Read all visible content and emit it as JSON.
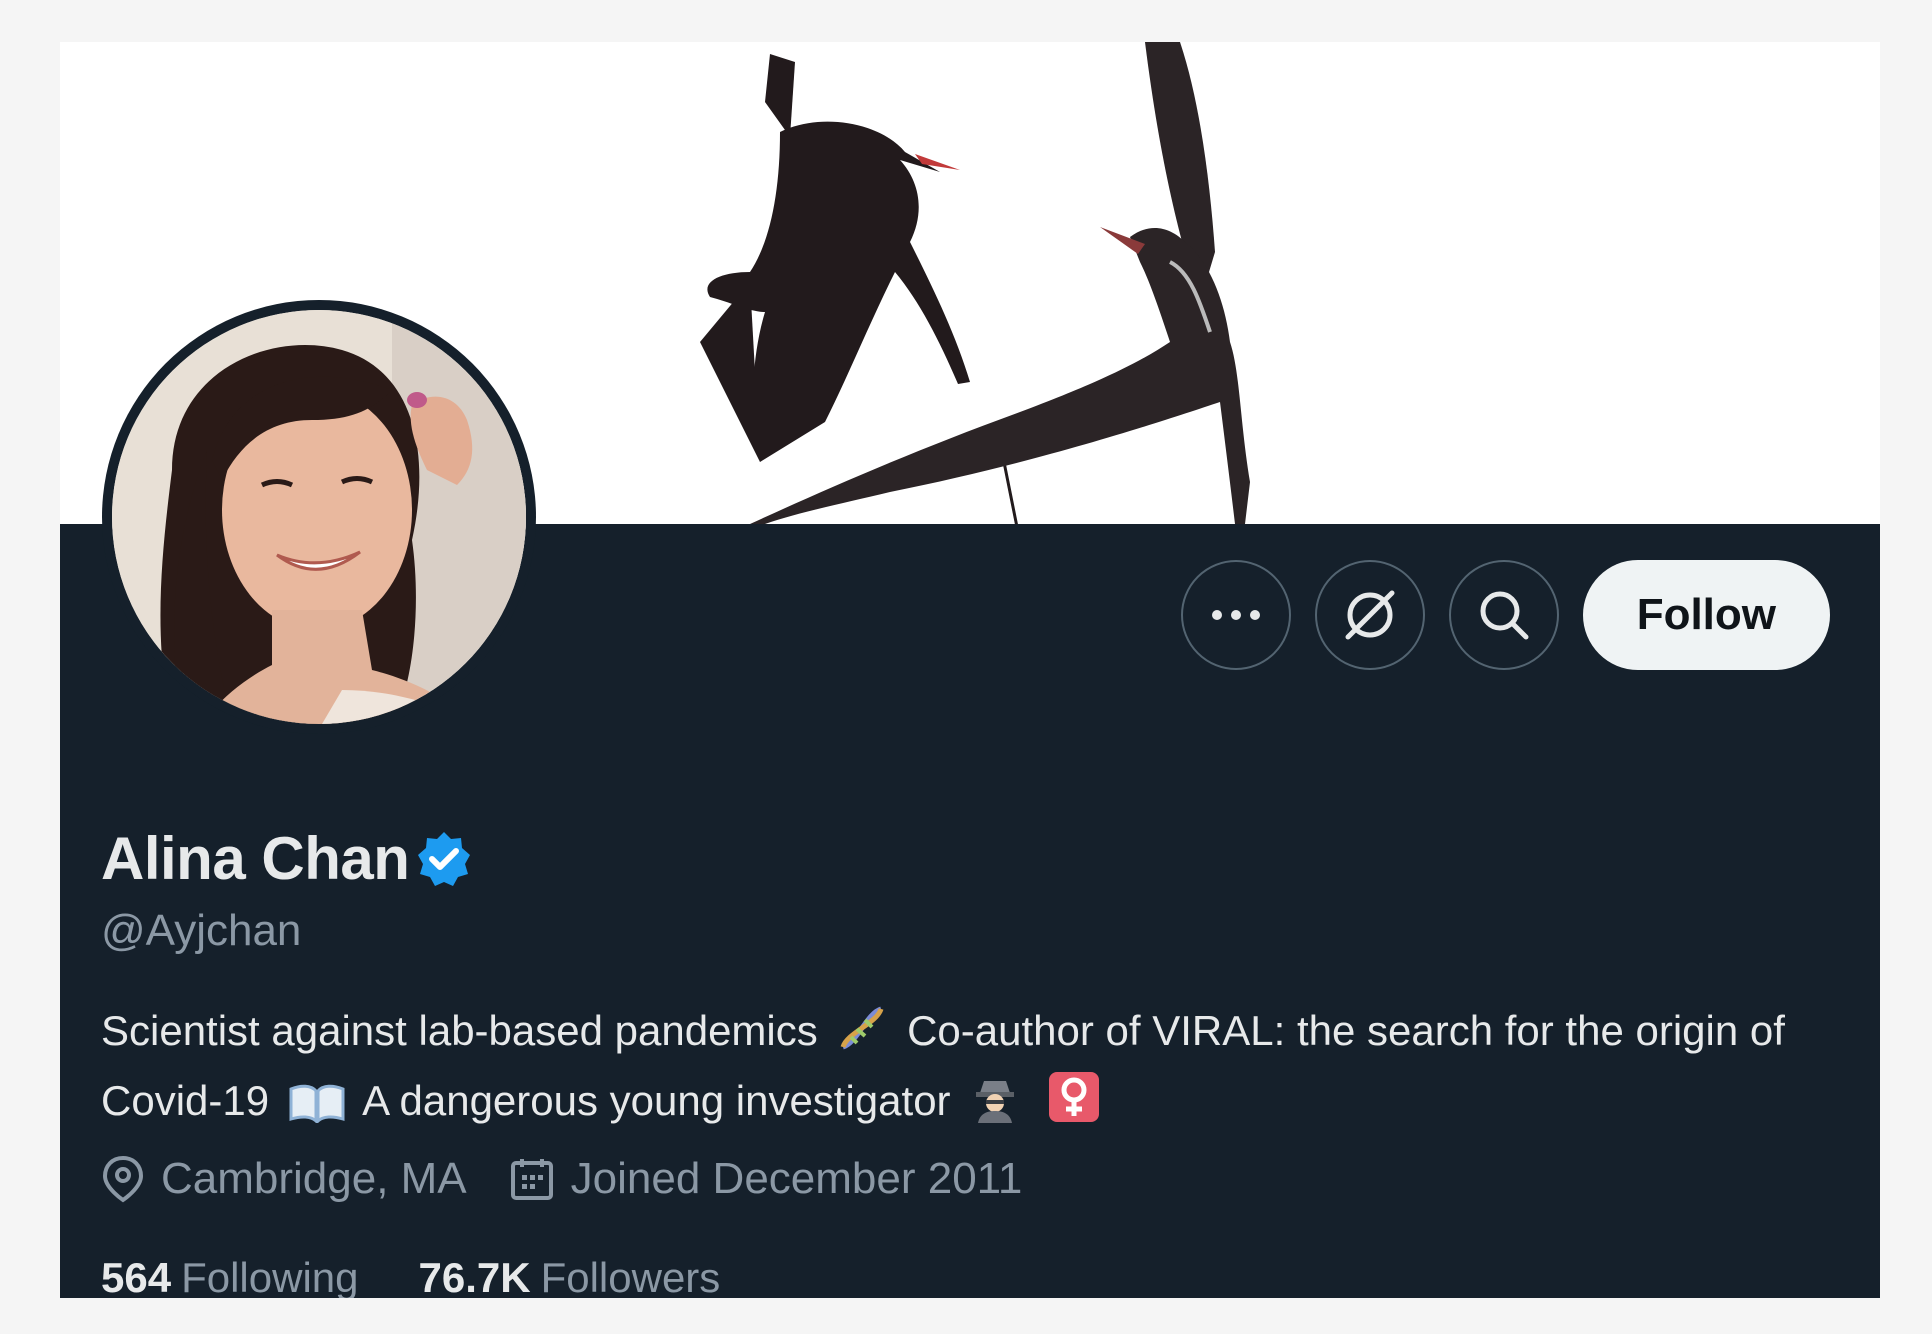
{
  "profile": {
    "name": "Alina Chan",
    "handle": "@Ayjchan",
    "verified": true,
    "bio": {
      "line1_text": "Scientist against lab-based pandemics",
      "line1_emoji": "dna-icon",
      "line1_rest": "Co-author of VIRAL: the search for the",
      "line2_text": "origin of Covid-19",
      "line2_emoji": "open-book-icon",
      "line2_rest": "A dangerous young investigator",
      "line2_tail_emojis": [
        "detective-icon",
        "female-sign-icon"
      ]
    },
    "location": "Cambridge, MA",
    "joined": "Joined December 2011",
    "following_count": "564",
    "following_label": "Following",
    "followers_count": "76.7K",
    "followers_label": "Followers"
  },
  "actions": {
    "more_icon": "more-icon",
    "grok_icon": "grok-icon",
    "search_icon": "search-icon",
    "follow_label": "Follow"
  },
  "colors": {
    "background": "#15202b",
    "text_primary": "#e7e9ea",
    "text_secondary": "#8b98a5",
    "verified_blue": "#1d9bf0",
    "follow_button_bg": "#eff3f4"
  }
}
